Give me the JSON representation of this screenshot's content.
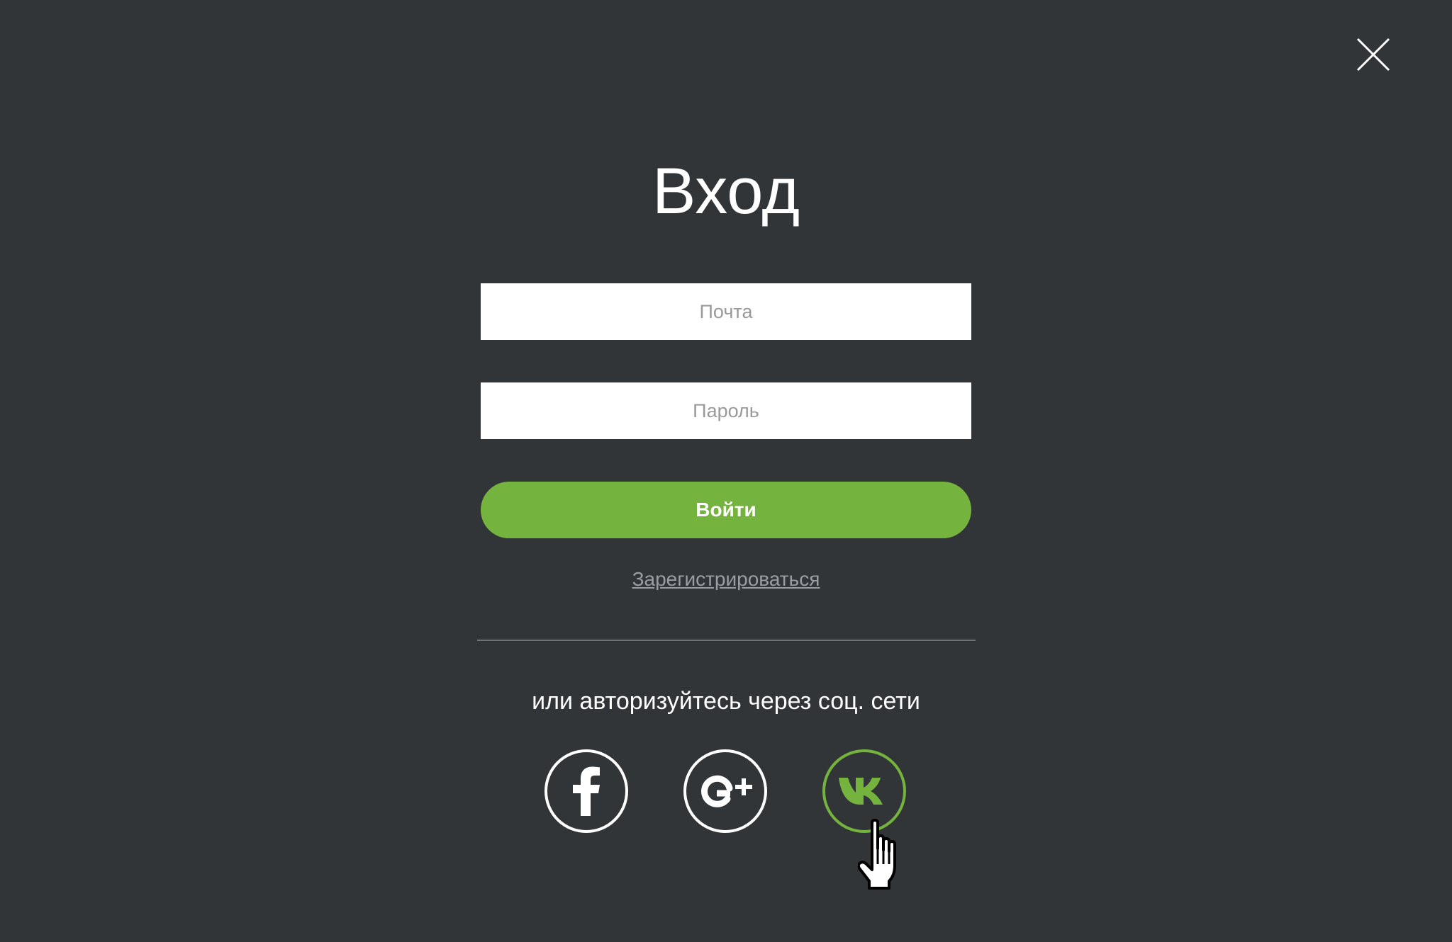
{
  "dialog": {
    "title": "Вход",
    "email_placeholder": "Почта",
    "password_placeholder": "Пароль",
    "submit_label": "Войти",
    "register_label": "Зарегистрироваться",
    "social_caption": "или авторизуйтесь через соц. сети"
  },
  "social": [
    {
      "name": "facebook",
      "icon": "facebook-icon"
    },
    {
      "name": "google-plus",
      "icon": "google-plus-icon"
    },
    {
      "name": "vk",
      "icon": "vk-icon"
    }
  ],
  "colors": {
    "background": "#313538",
    "accent": "#74b33d",
    "link": "#9a9ea2",
    "divider": "#6e7275"
  }
}
